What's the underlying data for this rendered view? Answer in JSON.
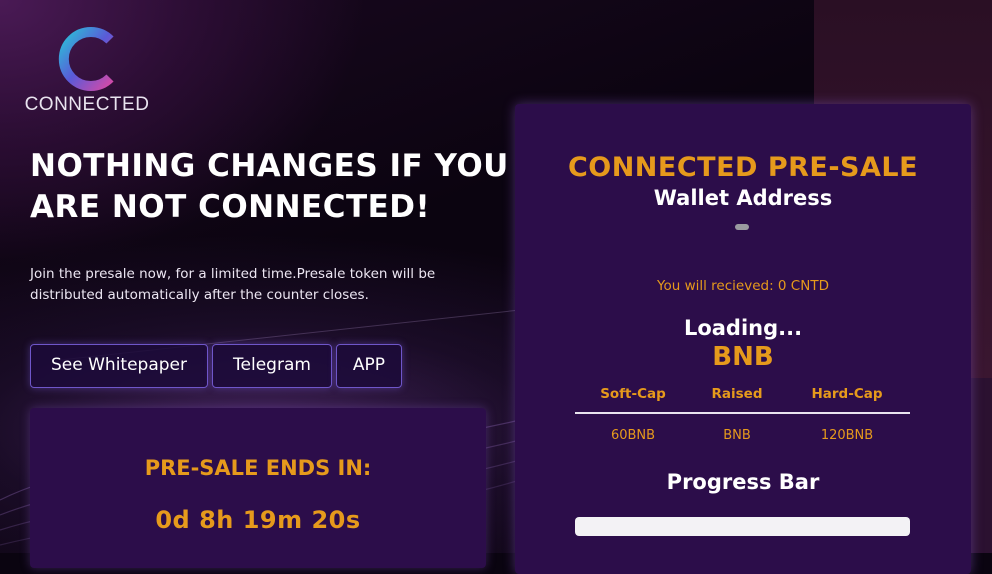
{
  "brand": {
    "logo_text": "CONNECTED"
  },
  "hero": {
    "headline": "NOTHING CHANGES IF YOU ARE NOT CONNECTED!",
    "intro": "Join the presale now, for a limited time.Presale token will be distributed automatically after the counter closes."
  },
  "buttons": {
    "whitepaper": "See Whitepaper",
    "telegram": "Telegram",
    "app": "APP"
  },
  "countdown": {
    "title": "PRE-SALE ENDS IN:",
    "value": "0d 8h 19m 20s"
  },
  "presale": {
    "title": "CONNECTED PRE-SALE",
    "wallet_label": "Wallet Address",
    "receive_text": "You will recieved: 0 CNTD",
    "loading": "Loading...",
    "currency": "BNB",
    "caps": {
      "headers": [
        "Soft-Cap",
        "Raised",
        "Hard-Cap"
      ],
      "values": [
        "60BNB",
        "BNB",
        "120BNB"
      ]
    },
    "progress_label": "Progress Bar",
    "progress_fraction": 0
  },
  "colors": {
    "accent": "#e69a1c",
    "card": "#2c0d4a",
    "button_border": "#6f56c9"
  },
  "icons": {
    "logo": "connected-c-logo-icon"
  }
}
